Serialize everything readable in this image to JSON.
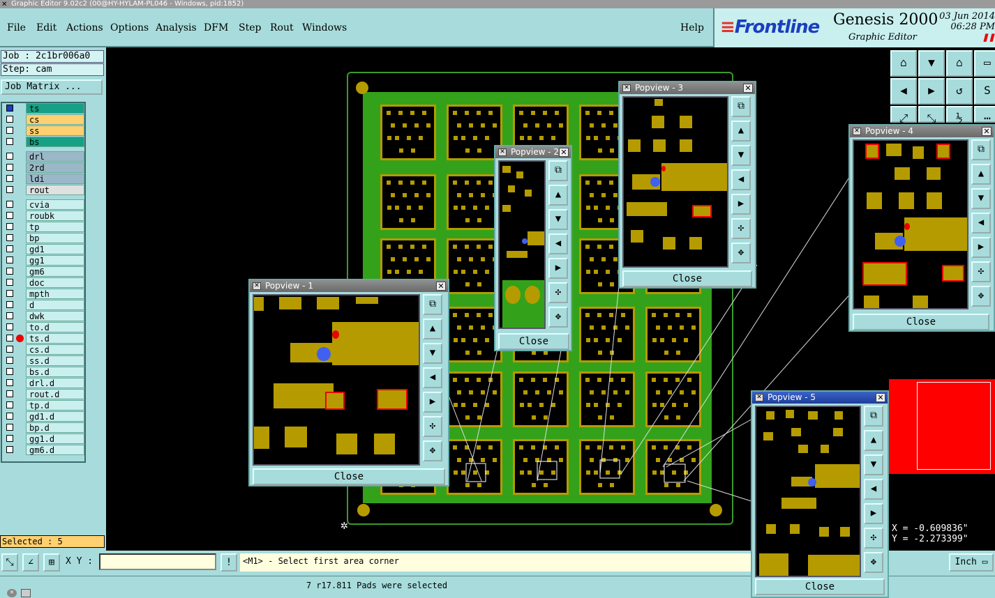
{
  "window": {
    "title": "Graphic Editor 9.02c2 (00@HY-HYLAM-PL046 - Windows, pid:1852)"
  },
  "menu": {
    "items": [
      "File",
      "Edit",
      "Actions",
      "Options",
      "Analysis",
      "DFM",
      "Step",
      "Rout",
      "Windows"
    ],
    "help": "Help"
  },
  "brand": {
    "logo": "Frontline",
    "product": "Genesis 2000",
    "subtitle": "Graphic Editor",
    "date": "03 Jun 2014",
    "time": "06:28 PM"
  },
  "left": {
    "job": "Job : 2c1br006a0",
    "step": "Step: cam",
    "matrix_button": "Job Matrix ...",
    "layers": [
      {
        "name": "ts",
        "color": "#16a085"
      },
      {
        "name": "cs",
        "color": "#ffd070"
      },
      {
        "name": "ss",
        "color": "#ffd070"
      },
      {
        "name": "bs",
        "color": "#16a085"
      },
      {
        "name": "drl",
        "color": "#9bb8c8"
      },
      {
        "name": "2rd",
        "color": "#9bb8c8"
      },
      {
        "name": "ldi",
        "color": "#9bb8c8"
      },
      {
        "name": "rout",
        "color": "#e0e0e0"
      },
      {
        "name": "cvia",
        "color": "#c9efef"
      },
      {
        "name": "roubk",
        "color": "#c9efef"
      },
      {
        "name": "tp",
        "color": "#c9efef"
      },
      {
        "name": "bp",
        "color": "#c9efef"
      },
      {
        "name": "gd1",
        "color": "#c9efef"
      },
      {
        "name": "gg1",
        "color": "#c9efef"
      },
      {
        "name": "gm6",
        "color": "#c9efef"
      },
      {
        "name": "doc",
        "color": "#c9efef"
      },
      {
        "name": "mpth",
        "color": "#c9efef"
      },
      {
        "name": "d",
        "color": "#c9efef"
      },
      {
        "name": "dwk",
        "color": "#c9efef"
      },
      {
        "name": "to.d",
        "color": "#c9efef"
      },
      {
        "name": "ts.d",
        "color": "#c9efef"
      },
      {
        "name": "cs.d",
        "color": "#c9efef"
      },
      {
        "name": "ss.d",
        "color": "#c9efef"
      },
      {
        "name": "bs.d",
        "color": "#c9efef"
      },
      {
        "name": "drl.d",
        "color": "#c9efef"
      },
      {
        "name": "rout.d",
        "color": "#c9efef"
      },
      {
        "name": "tp.d",
        "color": "#c9efef"
      },
      {
        "name": "gd1.d",
        "color": "#c9efef"
      },
      {
        "name": "bp.d",
        "color": "#c9efef"
      },
      {
        "name": "gg1.d",
        "color": "#c9efef"
      },
      {
        "name": "gm6.d",
        "color": "#c9efef"
      }
    ],
    "selected": "Selected : 5"
  },
  "popviews": [
    {
      "title": "Popview - 1",
      "close": "Close"
    },
    {
      "title": "Popview - 2",
      "close": "Close"
    },
    {
      "title": "Popview - 3",
      "close": "Close"
    },
    {
      "title": "Popview - 4",
      "close": "Close"
    },
    {
      "title": "Popview - 5",
      "close": "Close"
    }
  ],
  "coords": {
    "x": "X = -0.609836\"",
    "y": "Y = -2.273399\""
  },
  "command": {
    "xy_label": "X Y :",
    "xy_value": "",
    "prompt": "<M1> - Select first area corner",
    "units": "Inch"
  },
  "status": {
    "message": "7 r17.811 Pads were selected"
  },
  "colors": {
    "panel": "#a8dcdc",
    "copper": "#b59b00",
    "board": "#33a21a",
    "highlight": "#e00000"
  }
}
